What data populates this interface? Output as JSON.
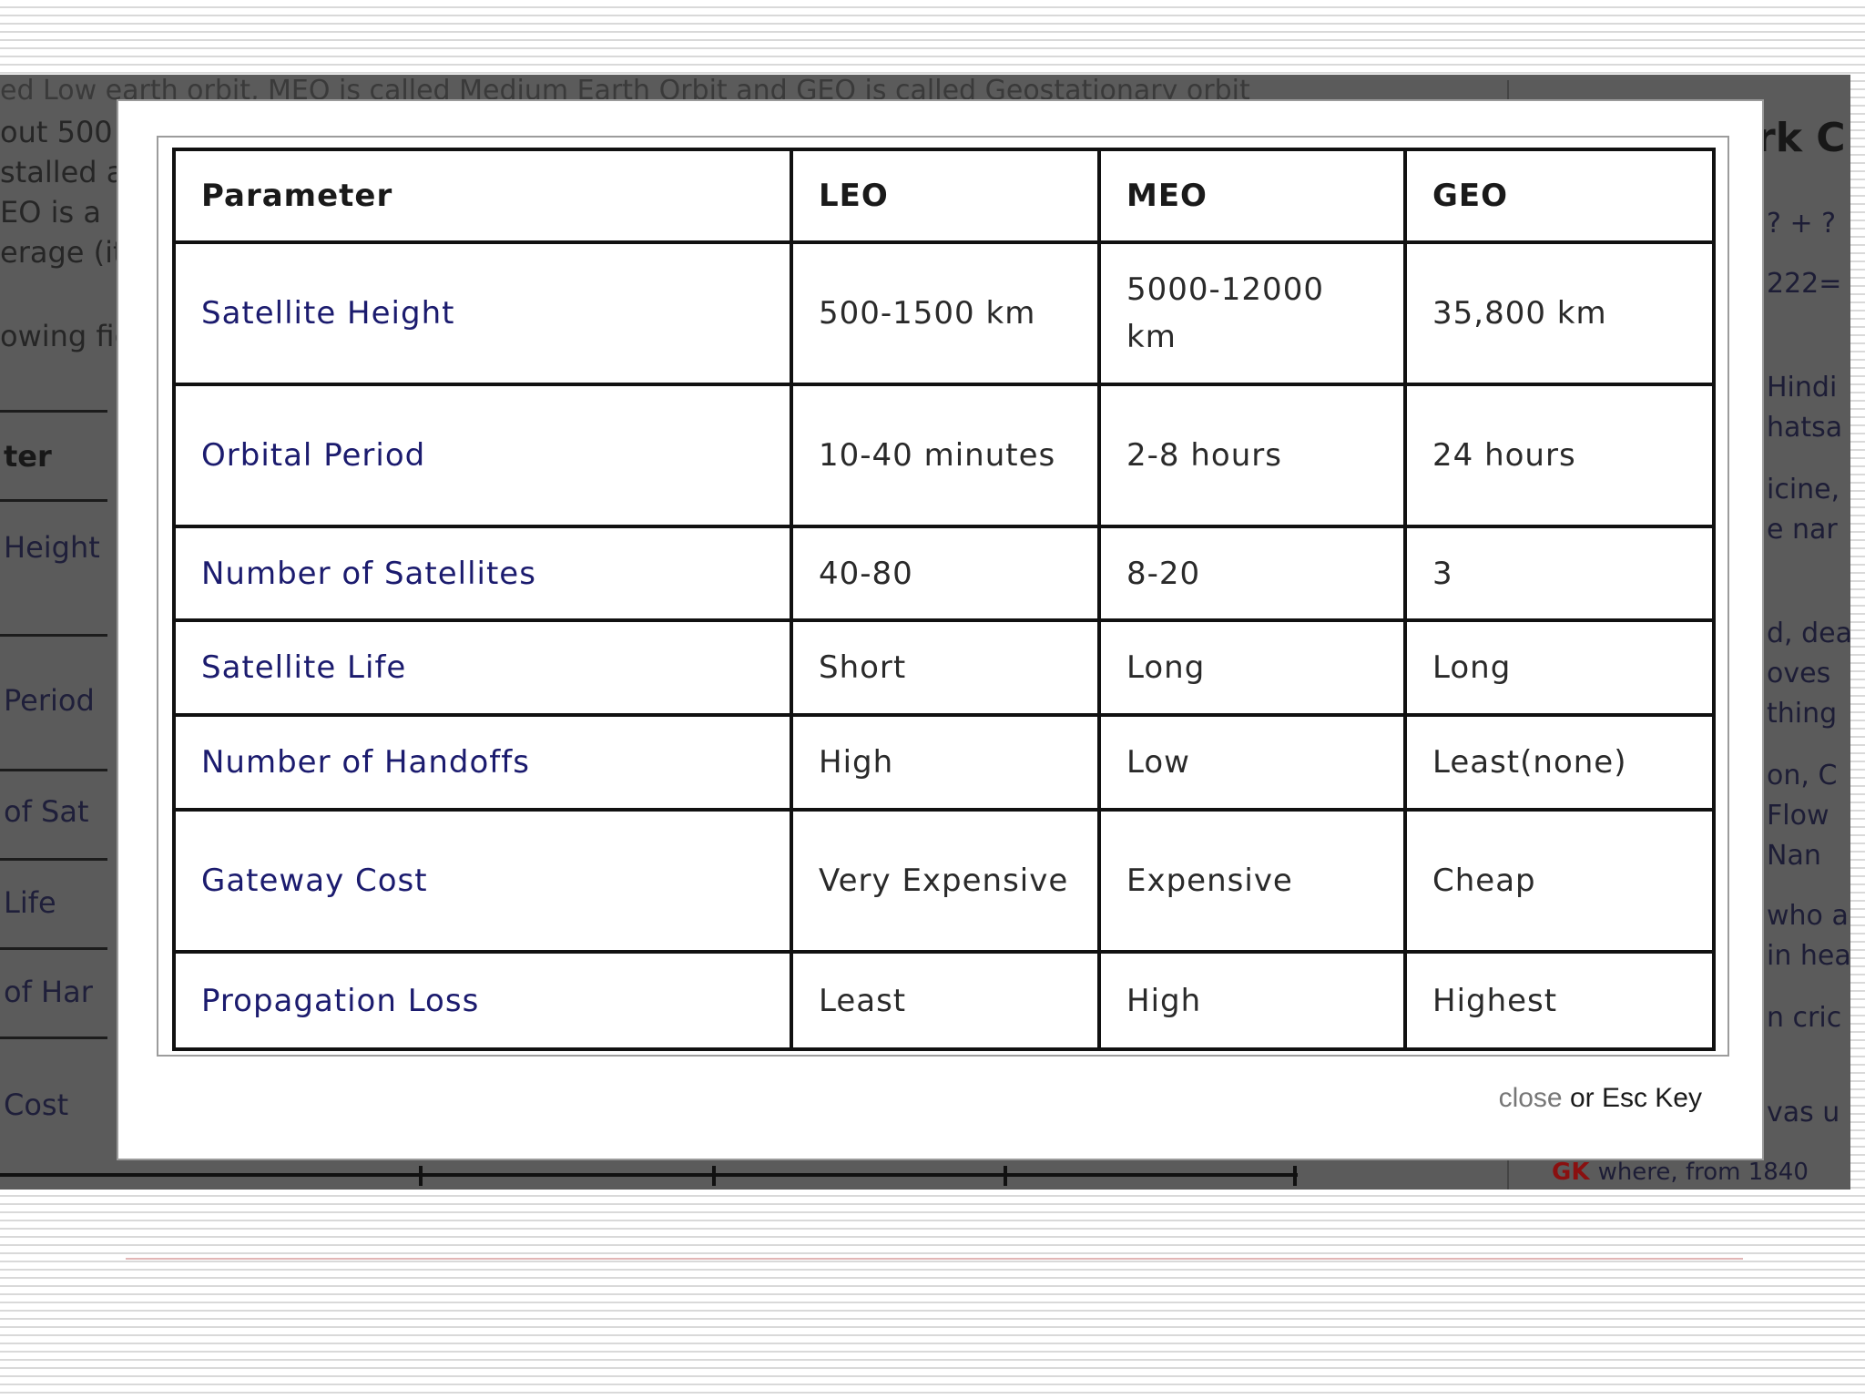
{
  "background": {
    "top_text": "ed Low earth orbit, MEO is called Medium Earth Orbit and GEO is called Geostationary orbit",
    "left_lines": [
      "out 500",
      "stalled a",
      "EO is a",
      "erage (it",
      "owing fig"
    ],
    "left_table_labels": [
      "ter",
      "Height",
      "Period",
      "of Sat",
      "Life",
      "of Har",
      "Cost"
    ],
    "right_title": "rk C",
    "right_lines": [
      "? + ?",
      "222=",
      "Hindi",
      "hatsa",
      "icine,",
      "e nar",
      "d, dea",
      "oves",
      "thing",
      "on, C",
      "Flow",
      "Nan",
      "who a",
      "in hea",
      "n cric",
      "vas u"
    ],
    "gk_logo": "GK",
    "gk_text": "where, from 1840"
  },
  "table": {
    "headers": [
      "Parameter",
      "LEO",
      "MEO",
      "GEO"
    ],
    "rows": [
      [
        "Satellite Height",
        "500-1500 km",
        "5000-12000 km",
        "35,800 km"
      ],
      [
        "Orbital Period",
        "10-40 minutes",
        "2-8 hours",
        "24 hours"
      ],
      [
        "Number of Satellites",
        "40-80",
        "8-20",
        "3"
      ],
      [
        "Satellite Life",
        "Short",
        "Long",
        "Long"
      ],
      [
        "Number of Handoffs",
        "High",
        "Low",
        "Least(none)"
      ],
      [
        "Gateway Cost",
        "Very Expensive",
        "Expensive",
        "Cheap"
      ],
      [
        "Propagation Loss",
        "Least",
        "High",
        "Highest"
      ]
    ]
  },
  "lightbox": {
    "close_label": "close",
    "close_suffix": " or Esc Key"
  }
}
